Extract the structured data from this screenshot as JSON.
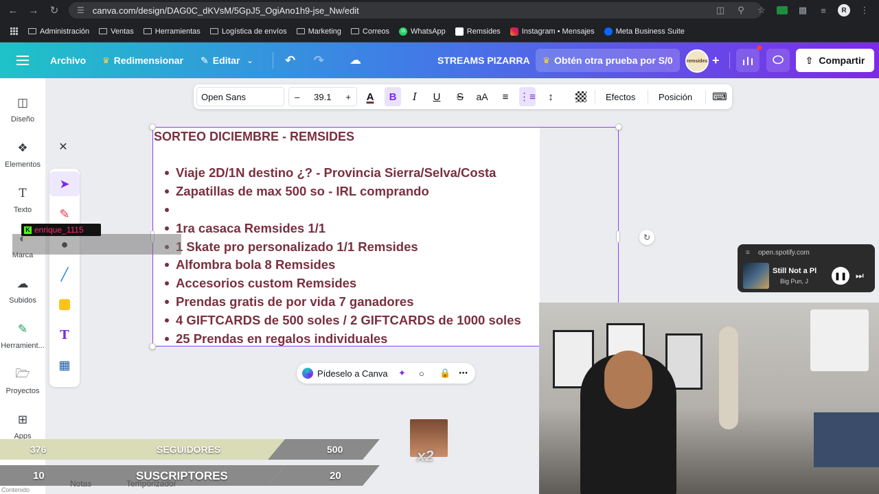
{
  "browser": {
    "url": "canva.com/design/DAG0C_dKVsM/5GpJ5_OgiAno1h9-jse_Nw/edit",
    "bookmarks": [
      "Administración",
      "Ventas",
      "Herramientas",
      "Logística de envíos",
      "Marketing",
      "Correos",
      "WhatsApp",
      "Remsides",
      "Instagram • Mensajes",
      "Meta Business Suite"
    ]
  },
  "topbar": {
    "file": "Archivo",
    "resize": "Redimensionar",
    "edit": "Editar",
    "title": "STREAMS PIZARRA",
    "promo": "Obtén otra prueba por S/0",
    "brand_avatar": "remsides",
    "share": "Compartir"
  },
  "sidebar": {
    "items": [
      {
        "label": "Diseño",
        "icon": "layout-icon"
      },
      {
        "label": "Elementos",
        "icon": "shapes-icon"
      },
      {
        "label": "Texto",
        "icon": "text-icon"
      },
      {
        "label": "Marca",
        "icon": "brand-icon"
      },
      {
        "label": "Subidos",
        "icon": "upload-icon"
      },
      {
        "label": "Herramient...",
        "icon": "tools-icon"
      },
      {
        "label": "Proyectos",
        "icon": "folder-icon"
      },
      {
        "label": "Apps",
        "icon": "apps-icon"
      }
    ],
    "footer": [
      "Contenido",
      "Notas",
      "Temporizador"
    ]
  },
  "text_toolbar": {
    "font": "Open Sans",
    "size": "39.1",
    "effects": "Efectos",
    "position": "Posición"
  },
  "document": {
    "title": "SORTEO DICIEMBRE - REMSIDES",
    "bullets": [
      "Viaje 2D/1N destino ¿? - Provincia Sierra/Selva/Costa",
      "Zapatillas de max 500 so - IRL comprando",
      "",
      "1ra casaca Remsides 1/1",
      "1 Skate pro personalizado 1/1 Remsides",
      "Alfombra bola 8 Remsides",
      "Accesorios custom Remsides",
      "Prendas gratis de por vida 7 ganadores",
      "4 GIFTCARDS de 500 soles / 2 GIFTCARDS de 1000 soles",
      "25 Prendas en regalos individuales"
    ],
    "text_color": "#7a2f3f"
  },
  "ask_canva": "Pídeselo a Canva",
  "overlay": {
    "username": "enrique_1115",
    "spotify": {
      "domain": "open.spotify.com",
      "track": "Still Not a Pl",
      "artist": "Big Pun, J"
    },
    "followers": {
      "current": "376",
      "label": "SEGUIDORES",
      "goal": "500"
    },
    "subscribers": {
      "current": "10",
      "label": "SUSCRIPTORES",
      "goal": "20"
    },
    "emote_multiplier": "x2"
  },
  "colors": {
    "accent": "#8b3dff",
    "teal": "#1ec3c8"
  }
}
